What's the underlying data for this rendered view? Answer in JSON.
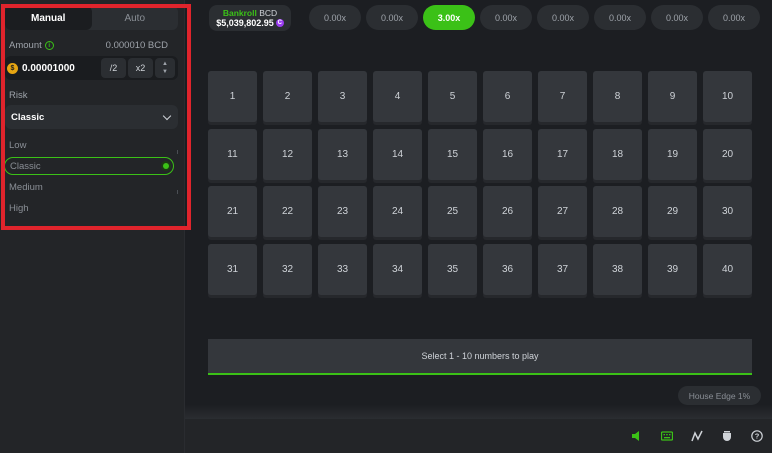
{
  "tabs": {
    "manual": "Manual",
    "auto": "Auto"
  },
  "amount": {
    "label": "Amount",
    "info_icon": "info-icon",
    "currency_value": "0.000010 BCD",
    "bet_value": "0.00001000",
    "coin_symbol": "$",
    "half_label": "/2",
    "double_label": "x2"
  },
  "risk": {
    "label": "Risk",
    "selected": "Classic",
    "options": [
      "Low",
      "Classic",
      "Medium",
      "High"
    ],
    "selected_index": 1
  },
  "bankroll": {
    "label": "Bankroll",
    "currency": "BCD",
    "value": "$5,039,802.95",
    "coin_icon": "C"
  },
  "multipliers": [
    "0.00x",
    "0.00x",
    "3.00x",
    "0.00x",
    "0.00x",
    "0.00x",
    "0.00x",
    "0.00x"
  ],
  "active_multiplier_index": 2,
  "grid_numbers": [
    "1",
    "2",
    "3",
    "4",
    "5",
    "6",
    "7",
    "8",
    "9",
    "10",
    "11",
    "12",
    "13",
    "14",
    "15",
    "16",
    "17",
    "18",
    "19",
    "20",
    "21",
    "22",
    "23",
    "24",
    "25",
    "26",
    "27",
    "28",
    "29",
    "30",
    "31",
    "32",
    "33",
    "34",
    "35",
    "36",
    "37",
    "38",
    "39",
    "40"
  ],
  "status_message": "Select 1 - 10 numbers to play",
  "house_edge": "House Edge 1%",
  "bottom_icons": [
    "sound-icon",
    "keyboard-icon",
    "stats-icon",
    "fairness-icon",
    "help-icon"
  ],
  "help_glyph": "?",
  "colors": {
    "accent": "#3bc117",
    "highlight": "#e0242c",
    "tile": "#34373c",
    "background": "#1c1e22"
  }
}
